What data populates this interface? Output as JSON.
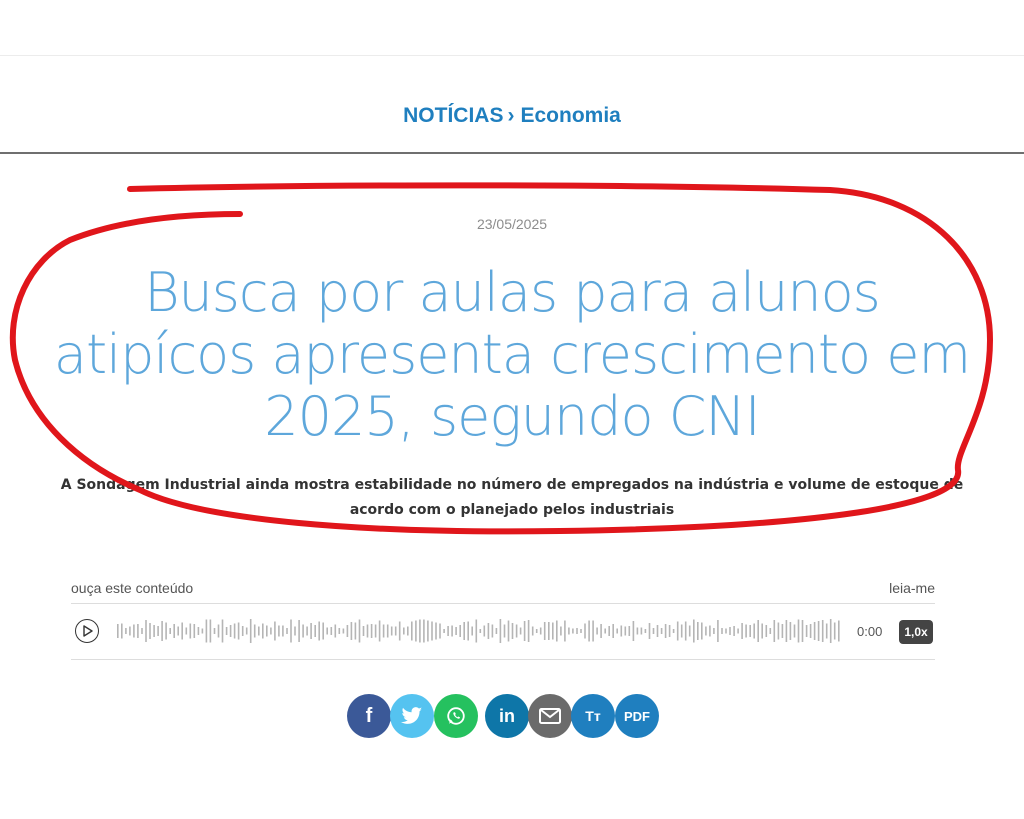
{
  "breadcrumb": {
    "section": "NOTÍCIAS",
    "separator": "›",
    "category": "Economia"
  },
  "article": {
    "date": "23/05/2025",
    "headline": "Busca por aulas para alunos atipícos apresenta crescimento em 2025, segundo CNI",
    "subtitle": "A Sondagem Industrial ainda mostra estabilidade no número de empregados na indústria e volume de estoque de acordo com o planejado pelos industriais"
  },
  "audio_player": {
    "listen_label": "ouça este conteúdo",
    "brand_label": "leia-me",
    "current_time": "0:00",
    "speed_label": "1,0x"
  },
  "share": [
    {
      "name": "facebook",
      "label": "f",
      "color": "#3b5998"
    },
    {
      "name": "twitter",
      "label": "",
      "color": "#55c3f0"
    },
    {
      "name": "whatsapp",
      "label": "",
      "color": "#25c15f"
    },
    {
      "name": "linkedin",
      "label": "in",
      "color": "#0e76a8"
    },
    {
      "name": "email",
      "label": "",
      "color": "#6b6b6b"
    },
    {
      "name": "font-size",
      "label": "Tт",
      "color": "#1f7fbf"
    },
    {
      "name": "pdf",
      "label": "PDF",
      "color": "#1f7fbf"
    }
  ],
  "colors": {
    "accent": "#1f7fbf",
    "headline": "#5ea7db",
    "annotation": "#e0161b"
  }
}
